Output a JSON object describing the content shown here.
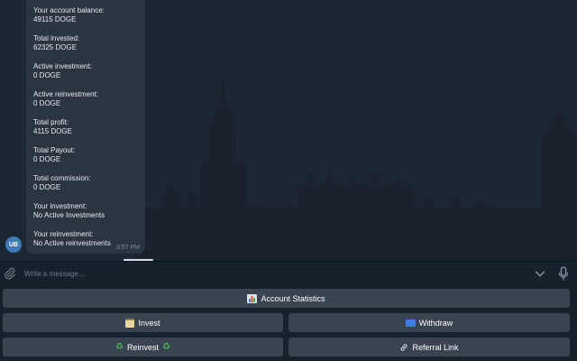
{
  "message": {
    "stats": [
      {
        "label": "Your account balance:",
        "value": "49115 DOGE"
      },
      {
        "label": "Total invested:",
        "value": "62325 DOGE"
      },
      {
        "label": "Active investment:",
        "value": "0 DOGE"
      },
      {
        "label": "Active reinvestment:",
        "value": "0 DOGE"
      },
      {
        "label": "Total profit:",
        "value": "4115 DOGE"
      },
      {
        "label": "Total Payout:",
        "value": "0 DOGE"
      },
      {
        "label": "Total commission:",
        "value": "0 DOGE"
      },
      {
        "label": "Your investment:",
        "value": "No Active Investments"
      },
      {
        "label": "Your reinvestment:",
        "value": "No Active reinvestments"
      }
    ],
    "time": "3:57 PM"
  },
  "sender": {
    "initials": "UB",
    "avatar_color": "#3c7ab8"
  },
  "composer": {
    "placeholder": "Write a message..."
  },
  "keyboard": {
    "account_statistics": "Account Statistics",
    "invest": "Invest",
    "withdraw": "Withdraw",
    "reinvest": "Reinvest",
    "referral_link": "Referral Link"
  },
  "icons": {
    "attach": "paperclip-icon",
    "scroll": "chevron-down-icon",
    "voice": "microphone-icon",
    "stats": "bar-chart-icon",
    "invest": "credit-card-icon",
    "withdraw": "atm-icon",
    "reinvest": "recycle-icon",
    "link": "link-icon"
  },
  "colors": {
    "background": "#1d2733",
    "bubble": "#2b3542",
    "button": "#3a4350",
    "panel": "#17212b"
  }
}
